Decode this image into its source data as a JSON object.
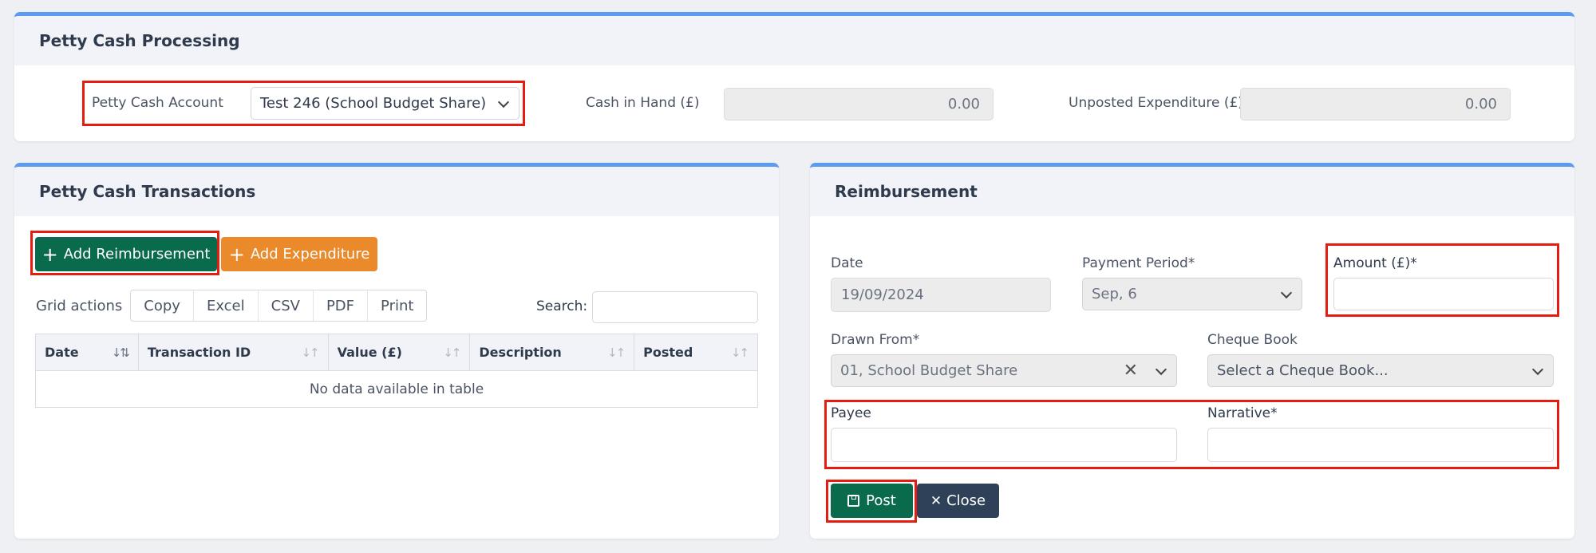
{
  "processing": {
    "title": "Petty Cash Processing",
    "account_label": "Petty Cash Account",
    "account_value": "Test 246 (School Budget Share)",
    "cash_label": "Cash in Hand (£)",
    "cash_value": "0.00",
    "unposted_label": "Unposted Expenditure (£)",
    "unposted_value": "0.00"
  },
  "transactions": {
    "title": "Petty Cash Transactions",
    "add_reimbursement": "Add Reimbursement",
    "add_expenditure": "Add Expenditure",
    "grid_actions_label": "Grid actions",
    "grid_buttons": [
      "Copy",
      "Excel",
      "CSV",
      "PDF",
      "Print"
    ],
    "search_label": "Search:",
    "columns": [
      "Date",
      "Transaction ID",
      "Value (£)",
      "Description",
      "Posted"
    ],
    "empty_text": "No data available in table"
  },
  "reimbursement": {
    "title": "Reimbursement",
    "date_label": "Date",
    "date_value": "19/09/2024",
    "period_label": "Payment Period*",
    "period_value": "Sep, 6",
    "amount_label": "Amount (£)*",
    "amount_value": "",
    "drawn_label": "Drawn From*",
    "drawn_value": "01, School Budget Share",
    "cheque_label": "Cheque Book",
    "cheque_placeholder": "Select a Cheque Book...",
    "payee_label": "Payee",
    "payee_value": "",
    "narrative_label": "Narrative*",
    "narrative_value": "",
    "post_label": "Post",
    "close_label": "Close"
  },
  "colors": {
    "accent_border": "#5b9cef",
    "primary_green": "#0a6b4c",
    "orange": "#ea8a2b",
    "dark": "#2e4158",
    "highlight_red": "#e41d10"
  }
}
